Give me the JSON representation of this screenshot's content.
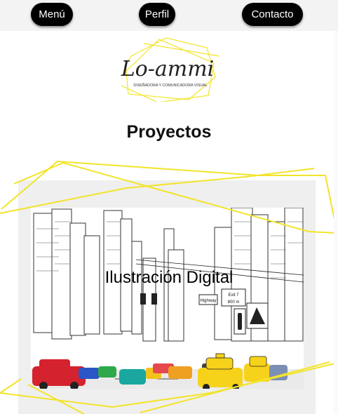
{
  "nav": {
    "menu_label": "Menú",
    "perfil_label": "Perfil",
    "contacto_label": "Contacto"
  },
  "logo": {
    "script_text": "Lo-ammi",
    "tagline": "DISEÑADORA Y COMUNICADORA VISUAL"
  },
  "page": {
    "title": "Proyectos"
  },
  "project_card": {
    "title": "Ilustración Digital",
    "image_name": "city-street-illustration",
    "signs": {
      "exit": "Exit 7",
      "highway": "Highway",
      "distance": "800 m"
    }
  },
  "colors": {
    "nav_button": "#000000",
    "accent_yellow": "#f2e42a",
    "card_bg": "#efefef",
    "topbar_bg": "#f3f3f3"
  }
}
